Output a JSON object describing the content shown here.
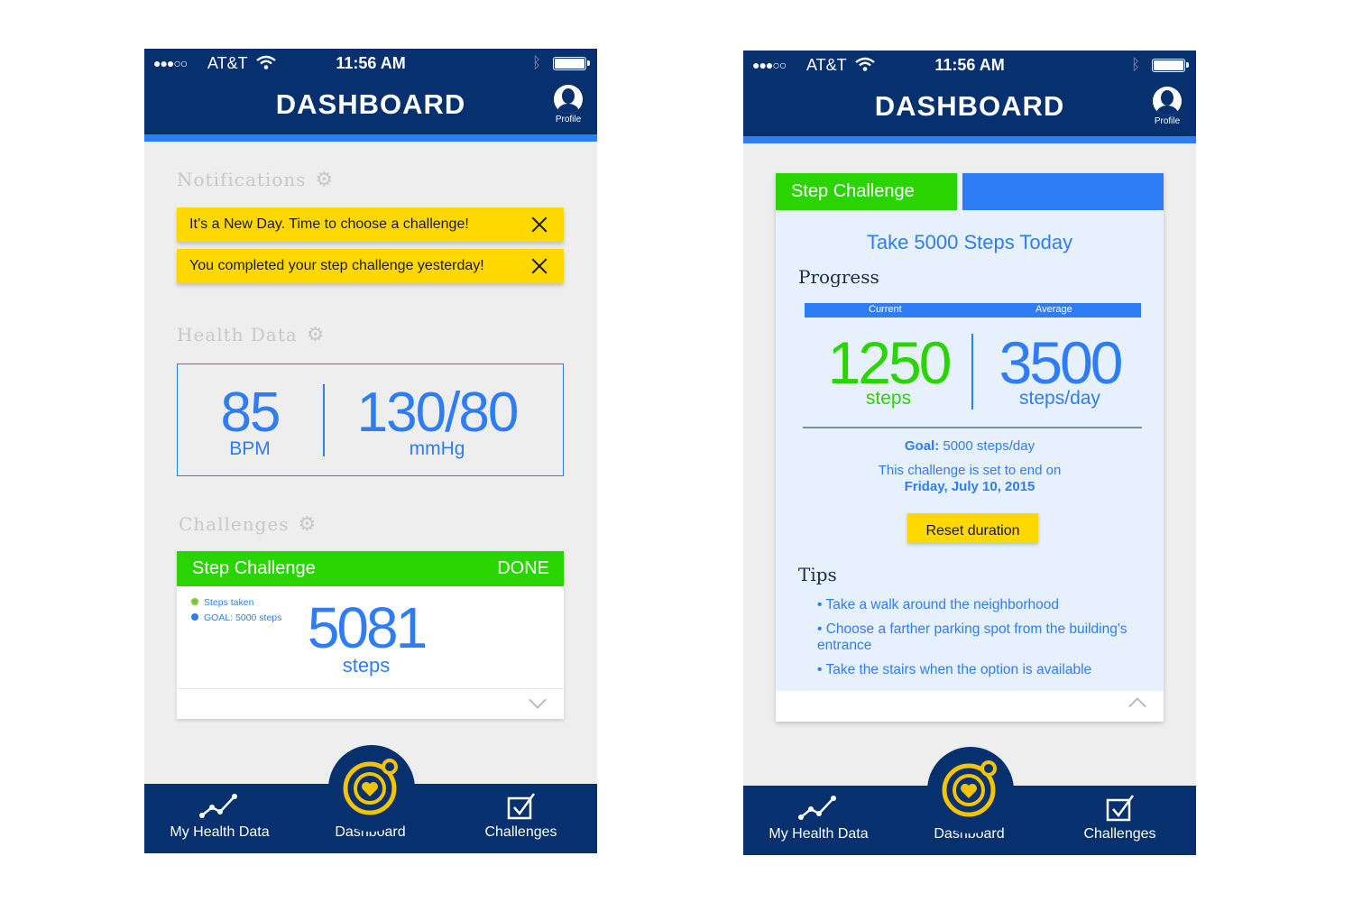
{
  "status": {
    "signal": "●●●○○",
    "carrier": "AT&T",
    "time": "11:56 AM"
  },
  "header": {
    "title": "DASHBOARD",
    "profile_label": "Profile"
  },
  "left": {
    "notifications_heading": "Notifications",
    "notifications": [
      "It’s a New Day. Time to choose a challenge!",
      "You completed your step challenge yesterday!"
    ],
    "health_heading": "Health Data",
    "heart_rate": {
      "value": "85",
      "unit": "BPM"
    },
    "blood_pressure": {
      "value": "130/80",
      "unit": "mmHg"
    },
    "challenges_heading": "Challenges",
    "challenge": {
      "name": "Step Challenge",
      "status": "DONE",
      "legend": [
        {
          "label": "Steps taken",
          "color": "#7fc63a"
        },
        {
          "label": "GOAL: 5000 steps",
          "color": "#2f7df4"
        }
      ],
      "steps": "5081",
      "unit": "steps"
    }
  },
  "right": {
    "tab_label": "Step Challenge",
    "title": "Take 5000 Steps Today",
    "progress_heading": "Progress",
    "current_label": "Current",
    "average_label": "Average",
    "current": {
      "value": "1250",
      "unit": "steps"
    },
    "average": {
      "value": "3500",
      "unit": "steps/day"
    },
    "goal_label": "Goal:",
    "goal_value": "5000 steps/day",
    "end_text": "This challenge is set to end on",
    "end_date": "Friday, July 10, 2015",
    "reset_label": "Reset duration",
    "tips_heading": "Tips",
    "tips": [
      "• Take a walk around the neighborhood",
      "• Choose a farther parking spot from the building's entrance",
      "• Take the stairs when the option is available"
    ]
  },
  "tabbar": {
    "health": "My Health Data",
    "dashboard": "Dashboard",
    "challenges": "Challenges"
  },
  "colors": {
    "navy": "#06306e",
    "blue": "#2f7df4",
    "green": "#2ad400",
    "yellow": "#ffd800",
    "gold": "#f5c400"
  }
}
